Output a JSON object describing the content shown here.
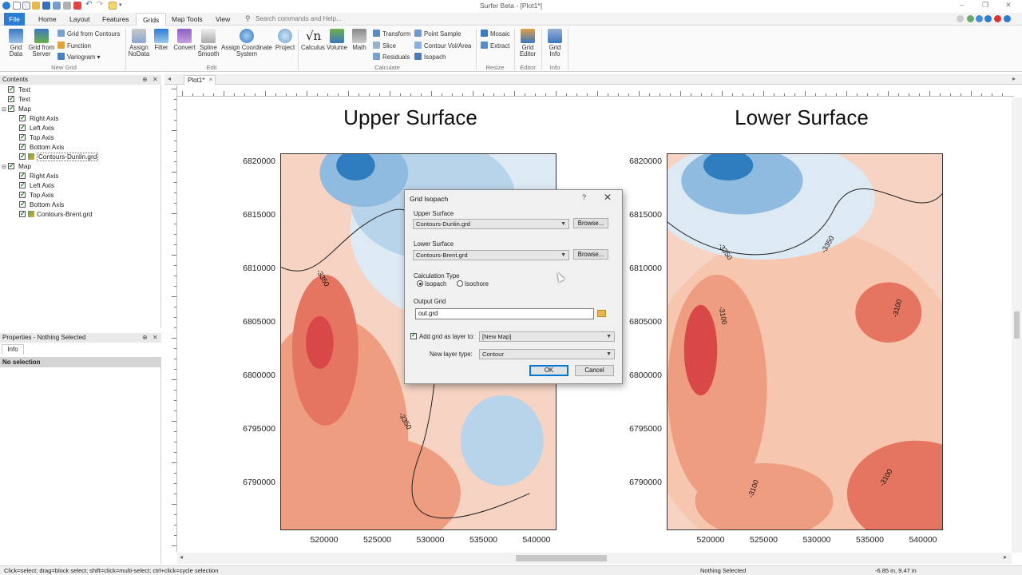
{
  "window": {
    "title": "Surfer Beta - [Plot1*]"
  },
  "menu": {
    "tabs": [
      "File",
      "Home",
      "Layout",
      "Features",
      "Grids",
      "Map Tools",
      "View"
    ],
    "active": "Grids",
    "search_placeholder": "Search commands and Help..."
  },
  "ribbon": {
    "new_grid": {
      "group": "New Grid",
      "grid_data": "Grid Data",
      "grid_from_server": "Grid from Server",
      "grid_from_contours": "Grid from Contours",
      "function": "Function",
      "variogram": "Variogram"
    },
    "edit": {
      "group": "Edit",
      "assign_nodata": "Assign NoData",
      "filter": "Filter",
      "convert": "Convert",
      "spline_smooth": "Spline Smooth",
      "assign_coordinate_system": "Assign Coordinate System",
      "project": "Project"
    },
    "calculate": {
      "group": "Calculate",
      "calculus": "Calculus",
      "volume": "Volume",
      "math": "Math",
      "transform": "Transform",
      "slice": "Slice",
      "residuals": "Residuals",
      "point_sample": "Point Sample",
      "contour_vol_area": "Contour Vol/Area",
      "isopach": "Isopach"
    },
    "resize": {
      "group": "Resize",
      "mosaic": "Mosaic",
      "extract": "Extract"
    },
    "editor": {
      "group": "Editor",
      "grid_editor": "Grid Editor"
    },
    "info": {
      "group": "Info",
      "grid_info": "Grid Info"
    }
  },
  "contents": {
    "title": "Contents",
    "items": [
      {
        "label": "Text",
        "checked": true,
        "level": 0,
        "icon": "text-icon"
      },
      {
        "label": "Text",
        "checked": true,
        "level": 0,
        "icon": "text-icon"
      },
      {
        "label": "Map",
        "checked": true,
        "level": 0,
        "icon": "map-icon"
      },
      {
        "label": "Right Axis",
        "checked": true,
        "level": 1,
        "icon": "axis-icon"
      },
      {
        "label": "Left Axis",
        "checked": true,
        "level": 1,
        "icon": "axis-icon"
      },
      {
        "label": "Top Axis",
        "checked": true,
        "level": 1,
        "icon": "axis-icon"
      },
      {
        "label": "Bottom Axis",
        "checked": true,
        "level": 1,
        "icon": "axis-icon"
      },
      {
        "label": "Contours-Dunlin.grd",
        "checked": true,
        "level": 1,
        "icon": "contour-layer-icon"
      },
      {
        "label": "Map",
        "checked": true,
        "level": 0,
        "icon": "map-icon"
      },
      {
        "label": "Right Axis",
        "checked": true,
        "level": 1,
        "icon": "axis-icon"
      },
      {
        "label": "Left Axis",
        "checked": true,
        "level": 1,
        "icon": "axis-icon"
      },
      {
        "label": "Top Axis",
        "checked": true,
        "level": 1,
        "icon": "axis-icon"
      },
      {
        "label": "Bottom Axis",
        "checked": true,
        "level": 1,
        "icon": "axis-icon"
      },
      {
        "label": "Contours-Brent.grd",
        "checked": true,
        "level": 1,
        "icon": "contour-layer-icon"
      }
    ]
  },
  "properties": {
    "title": "Properties - Nothing Selected",
    "tab": "Info",
    "selection": "No selection"
  },
  "document": {
    "tab": "Plot1*"
  },
  "maps": [
    {
      "title": "Upper Surface",
      "y_ticks": [
        "6820000",
        "6815000",
        "6810000",
        "6805000",
        "6800000",
        "6795000",
        "6790000"
      ],
      "x_ticks": [
        "520000",
        "525000",
        "530000",
        "535000",
        "540000"
      ],
      "contour_labels": [
        "-3350",
        "-3350"
      ]
    },
    {
      "title": "Lower Surface",
      "y_ticks": [
        "6820000",
        "6815000",
        "6810000",
        "6805000",
        "6800000",
        "6795000",
        "6790000"
      ],
      "x_ticks": [
        "520000",
        "525000",
        "530000",
        "535000",
        "540000"
      ],
      "contour_labels": [
        "-3350",
        "-3350",
        "-3100",
        "-3100",
        "-3100",
        "-3100"
      ]
    }
  ],
  "dialog": {
    "title": "Grid Isopach",
    "help": "?",
    "upper_surface_label": "Upper Surface",
    "upper_surface_value": "Contours-Dunlin.grd",
    "lower_surface_label": "Lower Surface",
    "lower_surface_value": "Contours-Brent.grd",
    "browse": "Browse...",
    "calc_type_label": "Calculation Type",
    "isopach": "Isopach",
    "isochore": "Isochore",
    "output_grid_label": "Output Grid",
    "output_value": "out.grd",
    "add_layer_label": "Add grid as layer to:",
    "add_layer_value": "[New Map]",
    "new_layer_type_label": "New layer type:",
    "new_layer_type_value": "Contour",
    "ok": "OK",
    "cancel": "Cancel"
  },
  "status": {
    "hint": "Click=select; drag=block select; shift=click=multi-select; ctrl+click=cycle selection",
    "selection": "Nothing Selected",
    "coords": "-6.85 in, 9.47 in"
  },
  "colors": {
    "file_tab": "#2b7cd3",
    "high_red": "#d73a3a",
    "low_blue": "#2f7cbf"
  }
}
